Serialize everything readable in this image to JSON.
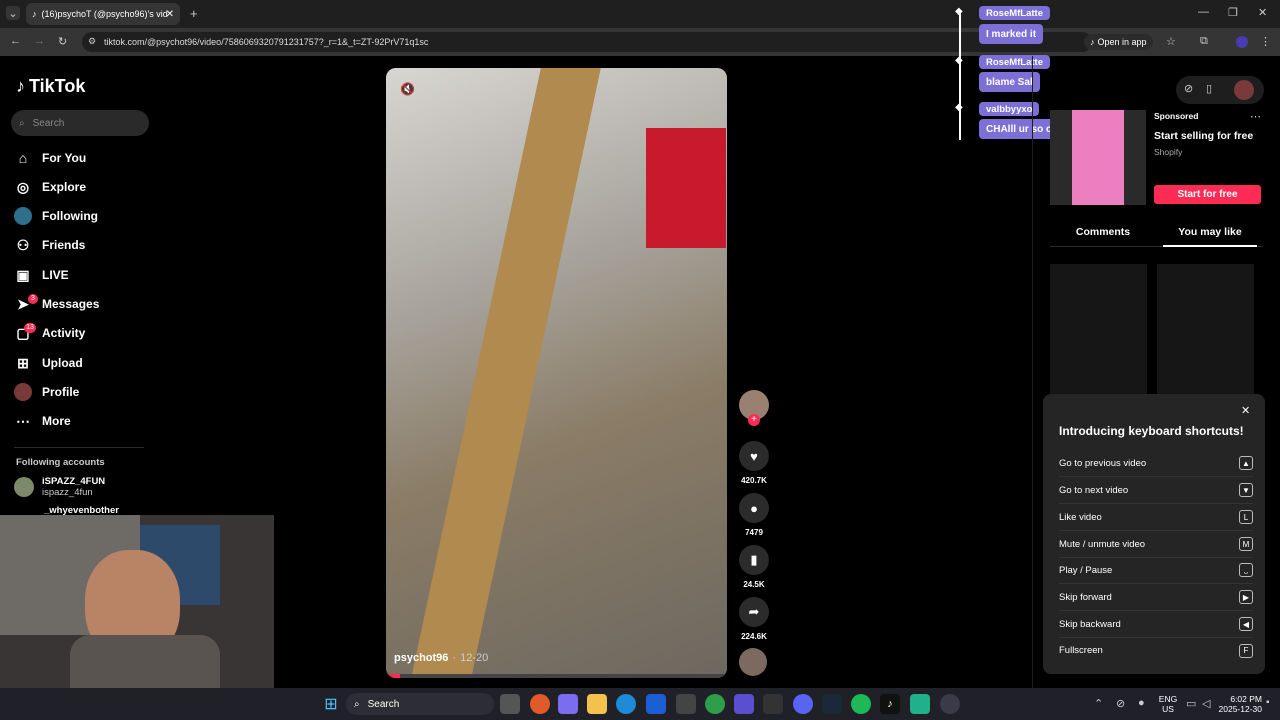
{
  "browser": {
    "tab_title": "(16)psychoT (@psycho96)'s vid",
    "url": "tiktok.com/@psychot96/video/7586069320791231757?_r=1&_t=ZT-92PrV71q1sc",
    "open_in_app": "Open in app"
  },
  "tiktok": {
    "logo": "TikTok",
    "search_placeholder": "Search",
    "nav": [
      {
        "label": "For You",
        "icon": "home-icon"
      },
      {
        "label": "Explore",
        "icon": "compass-icon"
      },
      {
        "label": "Following",
        "icon": "following-icon"
      },
      {
        "label": "Friends",
        "icon": "friends-icon"
      },
      {
        "label": "LIVE",
        "icon": "live-icon"
      },
      {
        "label": "Messages",
        "icon": "messages-icon",
        "badge": "3"
      },
      {
        "label": "Activity",
        "icon": "activity-icon",
        "badge": "13"
      },
      {
        "label": "Upload",
        "icon": "upload-icon"
      },
      {
        "label": "Profile",
        "icon": "profile-icon"
      },
      {
        "label": "More",
        "icon": "more-icon"
      }
    ],
    "following_header": "Following accounts",
    "following": [
      {
        "name": "iSPAZZ_4FUN",
        "handle": "ispazz_4fun"
      },
      {
        "name": "_whyevenbother",
        "handle": ""
      }
    ],
    "video": {
      "author": "psychot96",
      "date": "12-20",
      "likes": "420.7K",
      "comments": "7479",
      "saves": "24.5K",
      "shares": "224.6K"
    },
    "ad": {
      "sponsored": "Sponsored",
      "title": "Start selling for free",
      "brand": "Shopify",
      "cta": "Start for free"
    },
    "panel_tabs": [
      "Comments",
      "You may like"
    ],
    "shortcuts": {
      "title": "Introducing keyboard shortcuts!",
      "items": [
        {
          "label": "Go to previous video",
          "key": "▲"
        },
        {
          "label": "Go to next video",
          "key": "▼"
        },
        {
          "label": "Like video",
          "key": "L"
        },
        {
          "label": "Mute / unmute video",
          "key": "M"
        },
        {
          "label": "Play / Pause",
          "key": "⎵"
        },
        {
          "label": "Skip forward",
          "key": "▶"
        },
        {
          "label": "Skip backward",
          "key": "◀"
        },
        {
          "label": "Fullscreen",
          "key": "F"
        }
      ]
    }
  },
  "stream_chat": [
    {
      "user": "RoseMfLatte",
      "message": "I marked it"
    },
    {
      "user": "RoseMfLatte",
      "message": "blame Sal"
    },
    {
      "user": "valbbyyxo",
      "message": "CHAlll ur so cute"
    }
  ],
  "taskbar": {
    "search": "Search",
    "lang": "ENG",
    "region": "US",
    "time": "6:02 PM",
    "date": "2025-12-30"
  },
  "colors": {
    "accent": "#fe2c55",
    "chat": "#7c6fd6"
  }
}
